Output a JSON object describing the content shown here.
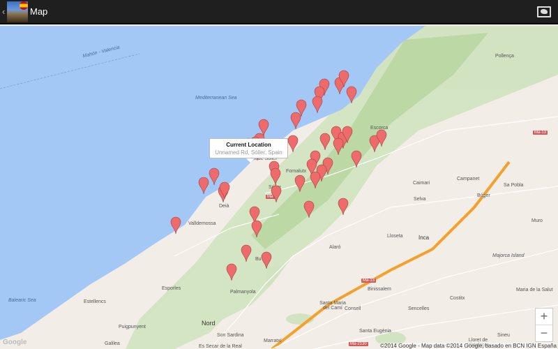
{
  "app": {
    "title": "Map",
    "icon": "cathedral-app-icon",
    "flag": "spain-flag",
    "back": "‹",
    "action_icon": "world-map-icon"
  },
  "tooltip": {
    "title": "Current Location",
    "address": "Unnamed Rd, Sóller, Spain"
  },
  "labels": {
    "ferry": "Mahón - Valencia",
    "med": "Mediterranean Sea",
    "balearic": "Balearic Sea",
    "pollenca": "Pollença",
    "escorca": "Escorca",
    "sapobla": "Sa Pobla",
    "campanet": "Campanet",
    "buger": "Búger",
    "caimari": "Caimari",
    "selva": "Selva",
    "muro": "Muro",
    "inca": "Inca",
    "majorca": "Majorca Island",
    "lloseta": "Lloseta",
    "alaro": "Alaró",
    "binissalem": "Binissalem",
    "consell": "Consell",
    "costitx": "Costitx",
    "sencelles": "Sencelles",
    "santamaria": "Santa Maria del Camí",
    "santaeugenia": "Santa Eugènia",
    "marratxi": "Marratxí",
    "sonsardina": "Son Sardina",
    "nord": "Nord",
    "puigpunyent": "Puigpunyent",
    "galilea": "Galilea",
    "esporles": "Esporles",
    "estellencs": "Estellencs",
    "valldemossa": "Valldemossa",
    "palmanyola": "Palmanyola",
    "bunyola": "Bu",
    "deia": "Deià",
    "soller": "Sóller",
    "fornalutx": "Fornalutx",
    "portsoller": "Port de Sóller",
    "sineu": "Sineu",
    "lloret": "Lloret de Vistalegre",
    "mariasalut": "Maria de la Salut",
    "essecar": "Es Secar de la Real"
  },
  "roads": {
    "ma13a": "Ma-13",
    "ma13b": "Ma-13",
    "ma2130": "Ma-2130",
    "ma10": "Ma-"
  },
  "zoom": {
    "in": "+",
    "out": "−"
  },
  "copyright": "©2014 Google - Map data ©2014 Google, basado en BCN IGN España",
  "logo": "Google",
  "markers": {
    "count": 43,
    "current_location_color": "#7ee06a",
    "marker_color": "#ee6b6b"
  }
}
